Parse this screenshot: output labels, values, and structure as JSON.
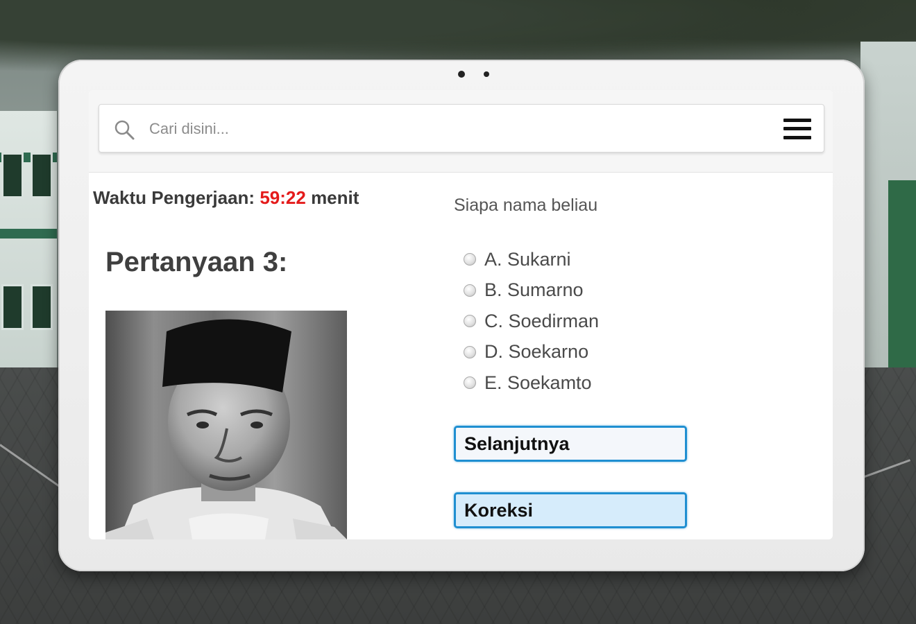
{
  "search": {
    "placeholder": "Cari disini..."
  },
  "timer": {
    "label": "Waktu Pengerjaan:",
    "time": "59:22",
    "unit": "menit"
  },
  "question": {
    "title": "Pertanyaan 3:",
    "text": "Siapa nama beliau",
    "options": [
      "A. Sukarni",
      "B. Sumarno",
      "C. Soedirman",
      "D. Soekarno",
      "E. Soekamto"
    ]
  },
  "buttons": {
    "next": "Selanjutnya",
    "correct": "Koreksi"
  },
  "colors": {
    "timer_value": "#e41b1b",
    "button_border": "#1f8fd1",
    "correct_button_bg": "#d6ecfb"
  },
  "icons": {
    "search": "search-icon",
    "menu": "hamburger-menu-icon"
  }
}
